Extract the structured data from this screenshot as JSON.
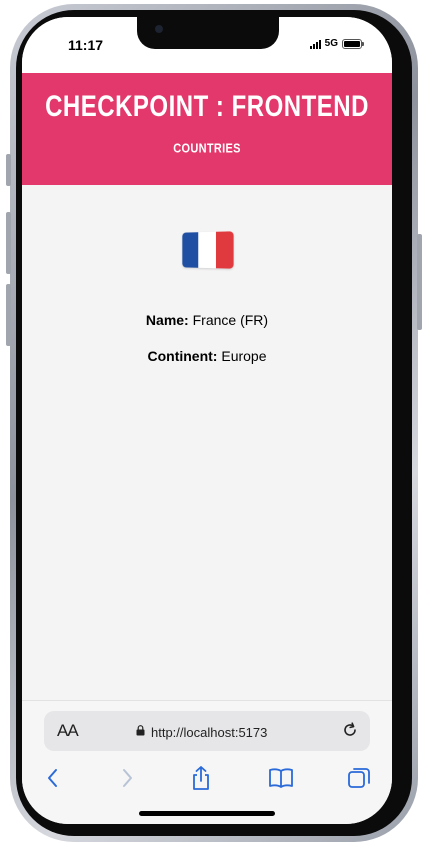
{
  "status_bar": {
    "time": "11:17",
    "network": "5G"
  },
  "header": {
    "title": "Checkpoint : frontend",
    "nav_link": "Countries",
    "background_color": "#e3386b"
  },
  "country": {
    "flag_icon": "france-flag-icon",
    "flag_colors": [
      "#1f4fa3",
      "#ffffff",
      "#e03a3e"
    ],
    "name_label": "Name:",
    "name_value": "France (FR)",
    "continent_label": "Continent:",
    "continent_value": "Europe"
  },
  "browser": {
    "text_size_button": "AA",
    "url": "http://localhost:5173",
    "icons": {
      "lock": "lock-icon",
      "reload": "reload-icon",
      "back": "back-chevron-icon",
      "forward": "forward-chevron-icon",
      "share": "share-icon",
      "bookmarks": "bookmarks-icon",
      "tabs": "tabs-icon"
    },
    "accent_color": "#2a6ad9"
  }
}
